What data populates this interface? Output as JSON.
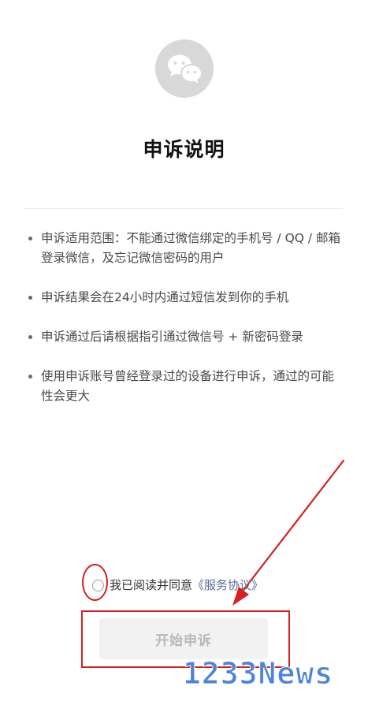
{
  "logo": {
    "icon": "wechat-chat-bubbles-icon",
    "color": "#d8d8d8"
  },
  "title": "申诉说明",
  "notes": [
    "申诉适用范围：不能通过微信绑定的手机号 / QQ / 邮箱登录微信，及忘记微信密码的用户",
    "申诉结果会在24小时内通过短信发到你的手机",
    "申诉通过后请根据指引通过微信号 + 新密码登录",
    "使用申诉账号曾经登录过的设备进行申诉，通过的可能性会更大"
  ],
  "agreement": {
    "checked": false,
    "prefix": "我已阅读并同意",
    "link": "《服务协议》",
    "link_color": "#576b95"
  },
  "start_button": {
    "label": "开始申诉",
    "enabled": false
  },
  "annotations": {
    "highlight_color": "#d61f1f"
  },
  "watermark": "1233News"
}
